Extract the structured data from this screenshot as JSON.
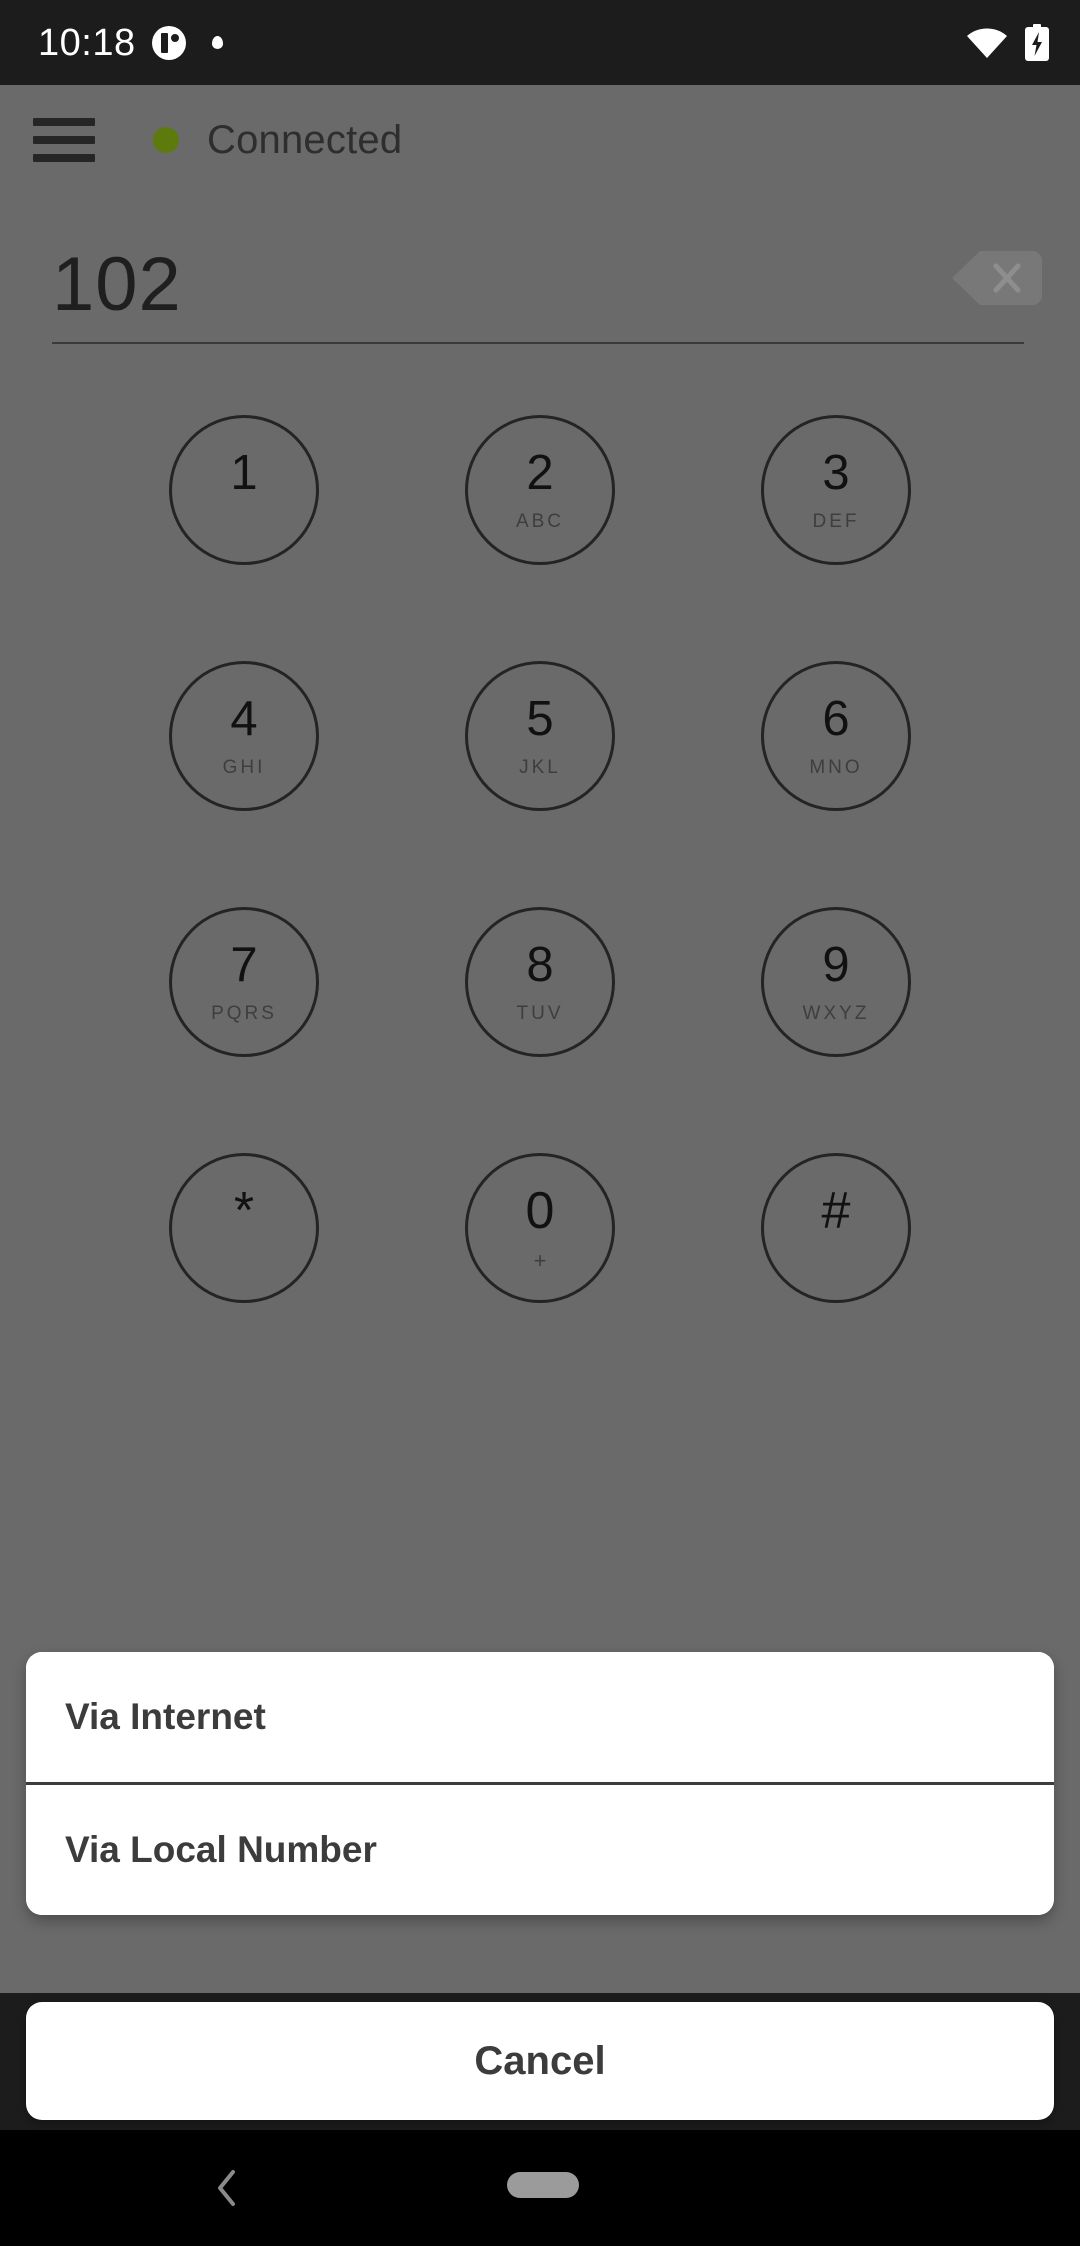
{
  "status_bar": {
    "time": "10:18",
    "icons": [
      "app-notification-icon",
      "dot-notification-icon",
      "wifi-icon",
      "battery-charging-icon"
    ]
  },
  "header": {
    "menu_icon": "hamburger-menu-icon",
    "status_dot_color": "#5d7a0d",
    "status_text": "Connected"
  },
  "number_entry": {
    "value": "102",
    "placeholder": "",
    "backspace_icon": "backspace-delete-icon"
  },
  "dialpad": {
    "rows": [
      [
        {
          "digit": "1",
          "letters": ""
        },
        {
          "digit": "2",
          "letters": "ABC"
        },
        {
          "digit": "3",
          "letters": "DEF"
        }
      ],
      [
        {
          "digit": "4",
          "letters": "GHI"
        },
        {
          "digit": "5",
          "letters": "JKL"
        },
        {
          "digit": "6",
          "letters": "MNO"
        }
      ],
      [
        {
          "digit": "7",
          "letters": "PQRS"
        },
        {
          "digit": "8",
          "letters": "TUV"
        },
        {
          "digit": "9",
          "letters": "WXYZ"
        }
      ],
      [
        {
          "digit": "*",
          "letters": ""
        },
        {
          "digit": "0",
          "letters": "+"
        },
        {
          "digit": "#",
          "letters": ""
        }
      ]
    ]
  },
  "action_sheet": {
    "options": [
      {
        "label": "Via Internet"
      },
      {
        "label": "Via Local Number"
      }
    ],
    "cancel_label": "Cancel"
  },
  "nav_bar": {
    "back_icon": "chevron-left-back-icon",
    "home_indicator": "home-pill-indicator"
  },
  "colors": {
    "dim_overlay": "#6a6a6a",
    "status_bar_bg": "#1c1c1c",
    "sheet_bg": "#ffffff",
    "accent_green": "#5d7a0d",
    "text_dark": "#3c3c3c"
  }
}
